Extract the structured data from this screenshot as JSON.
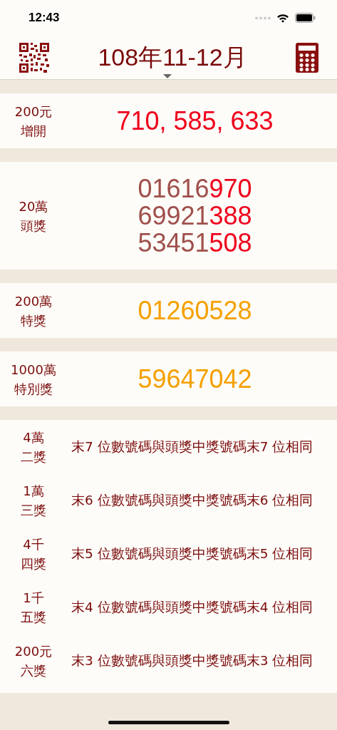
{
  "status_bar": {
    "time": "12:43"
  },
  "header": {
    "title": "108年11-12月"
  },
  "sections": [
    {
      "kind": "numbers",
      "amount": "200元",
      "prize": "增開",
      "color": "#f0001c",
      "lines": [
        {
          "bright": "710, 585, 633"
        }
      ]
    },
    {
      "kind": "numbers",
      "amount": "20萬",
      "prize": "頭獎",
      "color": "#f0001c",
      "lines": [
        {
          "dim": "01616",
          "bright": "970"
        },
        {
          "dim": "69921",
          "bright": "388"
        },
        {
          "dim": "53451",
          "bright": "508"
        }
      ]
    },
    {
      "kind": "numbers",
      "amount": "200萬",
      "prize": "特獎",
      "color": "#f5a000",
      "lines": [
        {
          "bright": "01260528"
        }
      ]
    },
    {
      "kind": "numbers",
      "amount": "1000萬",
      "prize": "特別獎",
      "color": "#f5a000",
      "lines": [
        {
          "bright": "59647042"
        }
      ]
    },
    {
      "kind": "rules",
      "rows": [
        {
          "amount": "4萬",
          "prize": "二獎",
          "rule": "末7 位數號碼與頭獎中獎號碼末7 位相同"
        },
        {
          "amount": "1萬",
          "prize": "三獎",
          "rule": "末6 位數號碼與頭獎中獎號碼末6 位相同"
        },
        {
          "amount": "4千",
          "prize": "四獎",
          "rule": "末5 位數號碼與頭獎中獎號碼末5 位相同"
        },
        {
          "amount": "1千",
          "prize": "五獎",
          "rule": "末4 位數號碼與頭獎中獎號碼末4 位相同"
        },
        {
          "amount": "200元",
          "prize": "六獎",
          "rule": "末3 位數號碼與頭獎中獎號碼末3 位相同"
        }
      ]
    }
  ]
}
